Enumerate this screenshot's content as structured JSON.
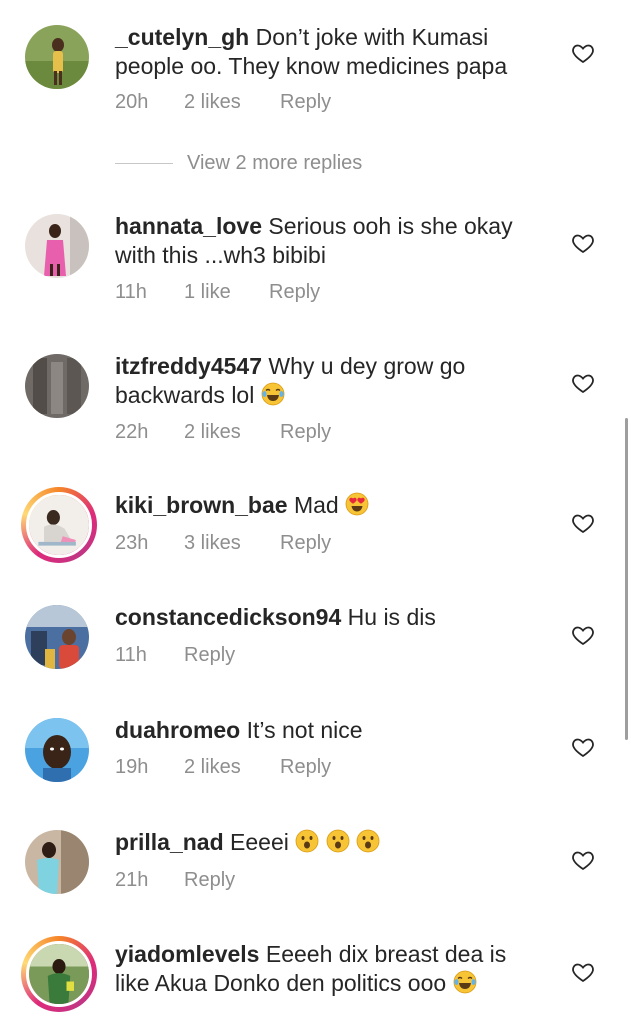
{
  "view_more_replies": "View 2 more replies",
  "comments": [
    {
      "username": "_cutelyn_gh",
      "text": "Don’t joke with Kumasi people oo. They know medicines papa",
      "time": "20h",
      "likes": "2 likes",
      "reply": "Reply",
      "emojis": []
    },
    {
      "username": "hannata_love",
      "text": "Serious ooh is she okay with this ...wh3 bibibi",
      "time": "11h",
      "likes": "1 like",
      "reply": "Reply",
      "emojis": []
    },
    {
      "username": "itzfreddy4547",
      "text": "Why u dey grow go backwards lol",
      "time": "22h",
      "likes": "2 likes",
      "reply": "Reply",
      "emojis": [
        "joy-emoji"
      ]
    },
    {
      "username": "kiki_brown_bae",
      "text": "Mad",
      "time": "23h",
      "likes": "3 likes",
      "reply": "Reply",
      "emojis": [
        "heart-eyes-emoji"
      ]
    },
    {
      "username": "constancedickson94",
      "text": "Hu is dis",
      "time": "11h",
      "likes": "",
      "reply": "Reply",
      "emojis": []
    },
    {
      "username": "duahromeo",
      "text": "It’s not nice",
      "time": "19h",
      "likes": "2 likes",
      "reply": "Reply",
      "emojis": []
    },
    {
      "username": "prilla_nad",
      "text": "Eeeei",
      "time": "21h",
      "likes": "",
      "reply": "Reply",
      "emojis": [
        "open-mouth-emoji",
        "open-mouth-emoji",
        "open-mouth-emoji"
      ]
    },
    {
      "username": "yiadomlevels",
      "text": "Eeeeh dix breast dea is like Akua Donko den politics ooo",
      "time": "",
      "likes": "",
      "reply": "",
      "emojis": [
        "joy-emoji"
      ]
    }
  ],
  "icons": {
    "like": "heart-outline-icon"
  },
  "colors": {
    "text": "#262626",
    "secondary": "#8e8e8e",
    "story_ring_start": "#f58529",
    "story_ring_end": "#dd2a7b"
  }
}
